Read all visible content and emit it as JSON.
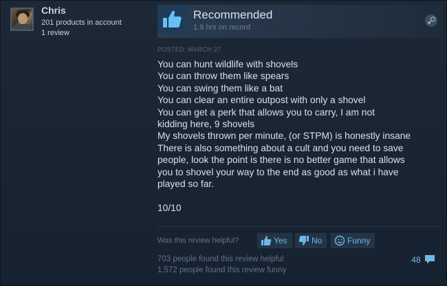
{
  "reviewer": {
    "name": "Chris",
    "products": "201 products in account",
    "reviews": "1 review"
  },
  "review": {
    "rating": "Recommended",
    "hours": "1.9 hrs on record",
    "posted": "POSTED: MARCH 27",
    "lines": [
      "You can hunt wildlife with shovels",
      "You can throw them like spears",
      "You can swing them like a bat",
      "You can clear an entire outpost with only a shovel",
      "You can get a perk that allows you to carry, I am not",
      "kidding here, 9 shovels",
      "My shovels thrown per minute, (or STPM) is honestly insane",
      "There is also something about a cult and you need to save",
      "people, look the point is there is no better game that allows",
      "you to shovel your way to the end as good as what i have",
      "played so far."
    ],
    "score": "10/10"
  },
  "feedback": {
    "question": "Was this review helpful?",
    "yes_label": "Yes",
    "no_label": "No",
    "funny_label": "Funny",
    "helpful_count": "703 people found this review helpful",
    "funny_count": "1,572 people found this review funny",
    "comment_count": "48"
  },
  "icons": {
    "thumb": "thumbs-up-icon",
    "steam": "steam-icon",
    "comment": "comment-bubble-icon"
  },
  "colors": {
    "accent": "#6fb9e6",
    "thumb_up": "#66c0f4",
    "text": "#d6e1ea",
    "muted": "#5f7385"
  }
}
